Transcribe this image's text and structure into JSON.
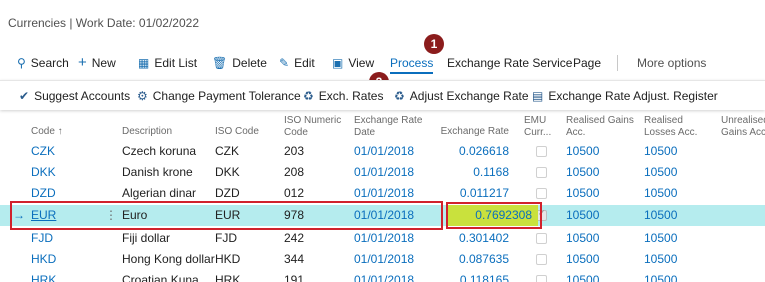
{
  "page": {
    "title": "Currencies | Work Date: 01/02/2022"
  },
  "actions": {
    "search": "Search",
    "new": "New",
    "edit_list": "Edit List",
    "delete": "Delete",
    "edit": "Edit",
    "view": "View",
    "process": "Process",
    "exchange_rate_service": "Exchange Rate Service",
    "page": "Page",
    "more": "More options"
  },
  "submenu": {
    "suggest_accounts": "Suggest Accounts",
    "change_payment_tolerance": "Change Payment Tolerance",
    "exch_rates": "Exch. Rates",
    "adjust_exchange_rate": "Adjust Exchange Rate",
    "adjust_register": "Exchange Rate Adjust. Register"
  },
  "callouts": {
    "one": "1",
    "two": "2"
  },
  "columns": {
    "code": "Code ↑",
    "description": "Description",
    "iso_code": "ISO Code",
    "iso_numeric_1": "ISO Numeric",
    "iso_numeric_2": "Code",
    "rate_date_1": "Exchange Rate",
    "rate_date_2": "Date",
    "rate": "Exchange Rate",
    "emu_1": "EMU",
    "emu_2": "Curr...",
    "rgains_1": "Realised Gains",
    "rgains_2": "Acc.",
    "rlosses_1": "Realised",
    "rlosses_2": "Losses Acc.",
    "ugains_1": "Unrealised",
    "ugains_2": "Gains Acc."
  },
  "rows": [
    {
      "code": "CZK",
      "desc": "Czech koruna",
      "iso": "CZK",
      "num": "203",
      "date": "01/01/2018",
      "rate": "0.026618",
      "emu": false,
      "rg": "10500",
      "rl": "10500"
    },
    {
      "code": "DKK",
      "desc": "Danish krone",
      "iso": "DKK",
      "num": "208",
      "date": "01/01/2018",
      "rate": "0.1168",
      "emu": false,
      "rg": "10500",
      "rl": "10500"
    },
    {
      "code": "DZD",
      "desc": "Algerian dinar",
      "iso": "DZD",
      "num": "012",
      "date": "01/01/2018",
      "rate": "0.011217",
      "emu": false,
      "rg": "10500",
      "rl": "10500"
    },
    {
      "code": "EUR",
      "desc": "Euro",
      "iso": "EUR",
      "num": "978",
      "date": "01/01/2018",
      "rate": "0.7692308",
      "emu": true,
      "rg": "10500",
      "rl": "10500"
    },
    {
      "code": "FJD",
      "desc": "Fiji dollar",
      "iso": "FJD",
      "num": "242",
      "date": "01/01/2018",
      "rate": "0.301402",
      "emu": false,
      "rg": "10500",
      "rl": "10500"
    },
    {
      "code": "HKD",
      "desc": "Hong Kong dollar",
      "iso": "HKD",
      "num": "344",
      "date": "01/01/2018",
      "rate": "0.087635",
      "emu": false,
      "rg": "10500",
      "rl": "10500"
    },
    {
      "code": "HRK",
      "desc": "Croatian Kuna",
      "iso": "HRK",
      "num": "191",
      "date": "01/01/2018",
      "rate": "0.118165",
      "emu": false,
      "rg": "10500",
      "rl": "10500"
    }
  ],
  "selected_row": {
    "arrow": "→",
    "dots": "⋮"
  },
  "colors": {
    "accent": "#0a6ebd",
    "selected_row": "#b5ecee",
    "highlight": "#c9e13d",
    "callout": "#8b1c1c",
    "annotation_box": "#d1222c"
  }
}
